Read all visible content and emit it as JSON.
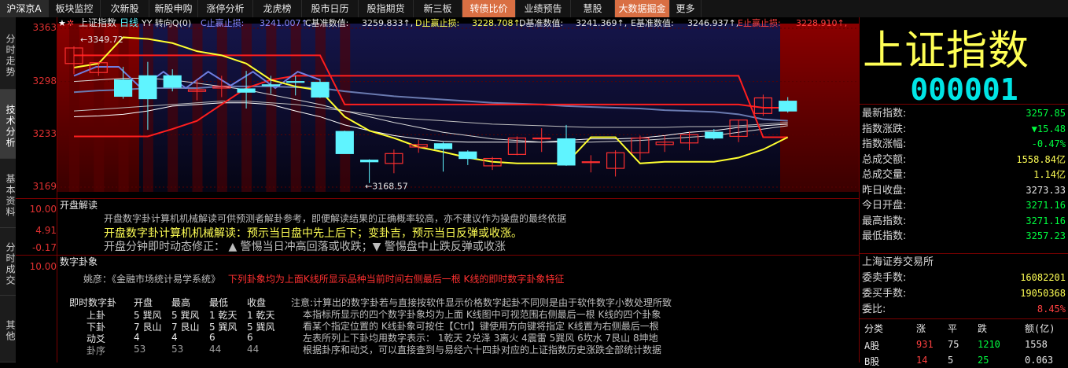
{
  "topbar": {
    "tabs": [
      "沪深京A",
      "板块监控",
      "次新股",
      "新股申购",
      "涨停分析",
      "龙虎榜",
      "股市日历",
      "股指期货",
      "新三板",
      "转债比价",
      "业绩预告",
      "慧股",
      "大数据掘金",
      "更多"
    ]
  },
  "sidetabs": [
    "分时走势",
    "技术分析",
    "基本资料",
    "分时成交",
    "其他"
  ],
  "price_axis": [
    "3363",
    "3298",
    "3233",
    "3169"
  ],
  "legend": {
    "title": "上证指数",
    "period": "日线",
    "ind": "YY 转向Q(0)",
    "c_label": "C止赢止损:",
    "c_val": "3241.007↑,",
    "cb_label": "C基准数值:",
    "cb_val": "3259.833↑,",
    "d_label": "D止赢止损:",
    "d_val": "3228.708↑,",
    "db_label": "D基准数值:",
    "db_val": "3241.369↑,",
    "eb_label": "E基准数值:",
    "eb_val": "3246.937↑,",
    "e_label": "E止赢止损:",
    "e_val": "3228.910↑,"
  },
  "chart_annotations": {
    "high_label": "←3349.72",
    "low_label": "←3168.57"
  },
  "chart_data": {
    "type": "candlestick",
    "ylim": [
      3169,
      3363
    ],
    "yticks": [
      3169,
      3233,
      3298,
      3363
    ],
    "candles": [
      {
        "o": 3320,
        "h": 3341,
        "l": 3307,
        "c": 3339
      },
      {
        "o": 3309,
        "h": 3322,
        "l": 3305,
        "c": 3321
      },
      {
        "o": 3300,
        "h": 3316,
        "l": 3277,
        "c": 3280
      },
      {
        "o": 3305,
        "h": 3322,
        "l": 3239,
        "c": 3277
      },
      {
        "o": 3305,
        "h": 3313,
        "l": 3286,
        "c": 3291
      },
      {
        "o": 3286,
        "h": 3300,
        "l": 3275,
        "c": 3288
      },
      {
        "o": 3290,
        "h": 3305,
        "l": 3279,
        "c": 3292
      },
      {
        "o": 3289,
        "h": 3311,
        "l": 3265,
        "c": 3285
      },
      {
        "o": 3294,
        "h": 3305,
        "l": 3283,
        "c": 3293
      },
      {
        "o": 3298,
        "h": 3305,
        "l": 3281,
        "c": 3297
      },
      {
        "o": 3297,
        "h": 3301,
        "l": 3278,
        "c": 3279
      },
      {
        "o": 3237,
        "h": 3238,
        "l": 3210,
        "c": 3210
      },
      {
        "o": 3202,
        "h": 3203,
        "l": 3174,
        "c": 3200
      },
      {
        "o": 3198,
        "h": 3215,
        "l": 3186,
        "c": 3210
      },
      {
        "o": 3218,
        "h": 3227,
        "l": 3211,
        "c": 3221
      },
      {
        "o": 3222,
        "h": 3224,
        "l": 3188,
        "c": 3216
      },
      {
        "o": 3212,
        "h": 3214,
        "l": 3196,
        "c": 3204
      },
      {
        "o": 3195,
        "h": 3206,
        "l": 3190,
        "c": 3204
      },
      {
        "o": 3209,
        "h": 3231,
        "l": 3208,
        "c": 3229
      },
      {
        "o": 3228,
        "h": 3241,
        "l": 3212,
        "c": 3229
      },
      {
        "o": 3228,
        "h": 3245,
        "l": 3195,
        "c": 3196
      },
      {
        "o": 3199,
        "h": 3208,
        "l": 3187,
        "c": 3200
      },
      {
        "o": 3192,
        "h": 3214,
        "l": 3182,
        "c": 3211
      },
      {
        "o": 3211,
        "h": 3232,
        "l": 3202,
        "c": 3229
      },
      {
        "o": 3221,
        "h": 3232,
        "l": 3212,
        "c": 3224
      },
      {
        "o": 3223,
        "h": 3237,
        "l": 3214,
        "c": 3233
      },
      {
        "o": 3236,
        "h": 3240,
        "l": 3227,
        "c": 3229
      },
      {
        "o": 3231,
        "h": 3251,
        "l": 3224,
        "c": 3251
      },
      {
        "o": 3259,
        "h": 3282,
        "l": 3256,
        "c": 3278
      },
      {
        "o": 3274,
        "h": 3279,
        "l": 3260,
        "c": 3262
      }
    ],
    "lines": {
      "red_upper": [
        3330,
        3330,
        3330,
        3330,
        3330,
        3330,
        3330,
        3330,
        3330,
        3330,
        3330,
        3270,
        3270,
        3270,
        3270,
        3270,
        3270,
        3270,
        3270,
        3270,
        3270,
        3270,
        3270,
        3270,
        3270,
        3270,
        3270,
        3270,
        3266,
        3266
      ],
      "red_lower": [
        3231,
        3231,
        3231,
        3231,
        3240,
        3250,
        3270,
        3290,
        3300,
        3305,
        3305,
        3305,
        3305,
        3305,
        3305,
        3305,
        3305,
        3305,
        3305,
        3305,
        3305,
        3305,
        3305,
        3305,
        3305,
        3305,
        3305,
        3305,
        3230,
        3230
      ],
      "yellow": [
        3315,
        3320,
        3352,
        3350,
        3345,
        3335,
        3330,
        3320,
        3300,
        3292,
        3287,
        3255,
        3238,
        3229,
        3218,
        3212,
        3205,
        3200,
        3198,
        3198,
        3198,
        3230,
        3230,
        3198,
        3200,
        3200,
        3200,
        3205,
        3215,
        3230
      ],
      "blue_zigzag": [
        3305,
        3316,
        3316,
        3290,
        3310,
        3290,
        3310,
        3293,
        3310,
        3290,
        3310,
        3300
      ],
      "slate": [
        3285,
        3287,
        3288,
        3290,
        3290,
        3290,
        3292,
        3292,
        3292,
        3291,
        3290,
        3286,
        3283,
        3280,
        3278,
        3276,
        3274,
        3272,
        3271,
        3270,
        3268,
        3267,
        3266,
        3265,
        3263,
        3262,
        3261,
        3258,
        3252,
        3250
      ],
      "white1": [
        3255,
        3256,
        3258,
        3262,
        3268,
        3270,
        3272,
        3272,
        3270,
        3262,
        3255,
        3245,
        3238,
        3232,
        3228,
        3225,
        3224,
        3224,
        3224,
        3224,
        3226,
        3228,
        3228,
        3229,
        3232,
        3236,
        3238,
        3242,
        3244,
        3246
      ],
      "white2": [
        3262,
        3264,
        3266,
        3268,
        3270,
        3272,
        3274,
        3274,
        3272,
        3270,
        3266,
        3262,
        3258,
        3254,
        3252,
        3250,
        3248,
        3246,
        3245,
        3244,
        3243,
        3242,
        3242,
        3242,
        3242,
        3243,
        3243,
        3244,
        3246,
        3248
      ],
      "white3": [
        3298,
        3300,
        3302,
        3302,
        3300,
        3296,
        3292,
        3288,
        3282,
        3276,
        3270,
        3262,
        3255,
        3248,
        3242,
        3236,
        3232,
        3228,
        3226,
        3224,
        3224,
        3224,
        3225,
        3226,
        3228,
        3230,
        3232,
        3236,
        3240,
        3244
      ]
    }
  },
  "panel1": {
    "yaxis": [
      "10.00",
      "4.91",
      "-0.17"
    ],
    "title": "开盘解读",
    "line1": "开盘数字卦计算机机械解读可供预测者解卦参考，即便解读结果的正确概率较高，亦不建议作为操盘的最终依据",
    "line2": "开盘数字卦计算机机械解读：预示当日盘中先上后下；变卦吉，预示当日反弹或收涨。",
    "line3": "开盘分钟即时动态修正：  ▲  警惕当日冲高回落或收跌；▼  警惕盘中止跌反弹或收涨"
  },
  "panel2": {
    "yaxis": [
      "10.00"
    ],
    "title": "数字卦象",
    "author_prefix": "姚彦：《金融市场统计易学系统》",
    "author_note": "下列卦象均为上面K线所显示品种当前时间右侧最后一根  K线的即时数字卦象特征",
    "table": {
      "headers": [
        "即时数字卦",
        "开盘",
        "最高",
        "最低",
        "收盘"
      ],
      "rows": [
        [
          "上卦",
          "5 巽风",
          "5 巽风",
          "1 乾天",
          "1 乾天"
        ],
        [
          "下卦",
          "7 艮山",
          "7 艮山",
          "5 巽风",
          "5 巽风"
        ],
        [
          "动爻",
          "4",
          "4",
          "6",
          "6"
        ],
        [
          "卦序",
          "53",
          "53",
          "44",
          "44"
        ]
      ]
    },
    "notes": [
      "注意:计算出的数字卦若与直接按软件显示价格数字起卦不同则是由于软件数字小数处理所致",
      "本指标所显示的四个数字卦象均为上面  K线图中可视范围右侧最后一根  K线的四个卦象",
      "看某个指定位置的  K线卦象可按住【Ctrl】键使用方向键将指定  K线置为右侧最后一根",
      "左表所列上下卦均用数字表示：  1乾天  2兑泽  3离火  4震雷  5巽风  6坎水  7艮山  8坤地",
      "根据卦序和动爻，可以直接查到与易经六十四卦对应的上证指数历史涨跌全部统计数据"
    ]
  },
  "quote": {
    "name": "上证指数",
    "code": "000001",
    "rows": [
      {
        "label": "最新指数:",
        "value": "3257.85",
        "color": "#00ff40"
      },
      {
        "label": "指数涨跌:",
        "value": "▼15.48",
        "color": "#00ff40"
      },
      {
        "label": "指数涨幅:",
        "value": "-0.47%",
        "color": "#00ff40"
      },
      {
        "label": "总成交额:",
        "value": "1558.84亿",
        "color": "#ffff55"
      },
      {
        "label": "总成交量:",
        "value": "1.14亿",
        "color": "#ffff55"
      },
      {
        "label": "昨日收盘:",
        "value": "3273.33",
        "color": "#e8e8e8"
      },
      {
        "label": "今日开盘:",
        "value": "3271.16",
        "color": "#00ff40"
      },
      {
        "label": "最高指数:",
        "value": "3271.16",
        "color": "#00ff40"
      },
      {
        "label": "最低指数:",
        "value": "3257.23",
        "color": "#00ff40"
      }
    ],
    "exchange": "上海证券交易所",
    "rows2": [
      {
        "label": "委卖手数:",
        "value": "16082201",
        "color": "#ffff55"
      },
      {
        "label": "委买手数:",
        "value": "19050368",
        "color": "#ffff55"
      },
      {
        "label": "委比:",
        "value": "8.45%",
        "color": "#ff4040"
      }
    ],
    "table_headers": [
      "分类",
      "涨",
      "平",
      "跌",
      "额(亿)"
    ],
    "table_rows": [
      [
        "A股",
        "931",
        "75",
        "1210",
        "1558"
      ],
      [
        "B股",
        "14",
        "5",
        "25",
        "0.063"
      ]
    ]
  }
}
